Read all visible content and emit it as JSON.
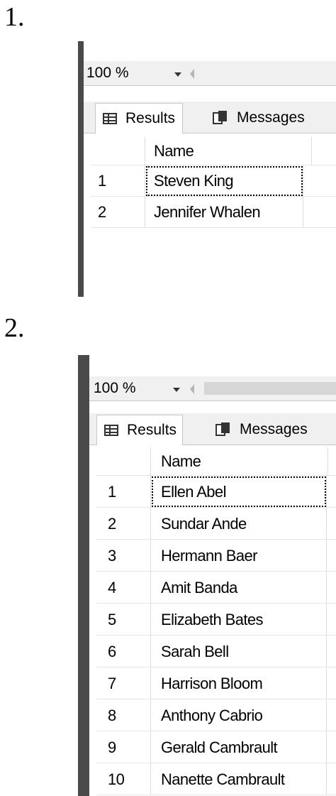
{
  "labels": [
    "1.",
    "2."
  ],
  "panels": [
    {
      "zoom": "100 %",
      "tabs": {
        "results": "Results",
        "messages": "Messages"
      },
      "column_header": "Name",
      "rows": [
        {
          "idx": "1",
          "name": "Steven King"
        },
        {
          "idx": "2",
          "name": "Jennifer Whalen"
        }
      ]
    },
    {
      "zoom": "100 %",
      "tabs": {
        "results": "Results",
        "messages": "Messages"
      },
      "column_header": "Name",
      "rows": [
        {
          "idx": "1",
          "name": "Ellen Abel"
        },
        {
          "idx": "2",
          "name": "Sundar Ande"
        },
        {
          "idx": "3",
          "name": "Hermann Baer"
        },
        {
          "idx": "4",
          "name": "Amit Banda"
        },
        {
          "idx": "5",
          "name": "Elizabeth Bates"
        },
        {
          "idx": "6",
          "name": "Sarah Bell"
        },
        {
          "idx": "7",
          "name": "Harrison Bloom"
        },
        {
          "idx": "8",
          "name": "Anthony Cabrio"
        },
        {
          "idx": "9",
          "name": "Gerald Cambrault"
        },
        {
          "idx": "10",
          "name": "Nanette Cambrault"
        }
      ]
    }
  ]
}
